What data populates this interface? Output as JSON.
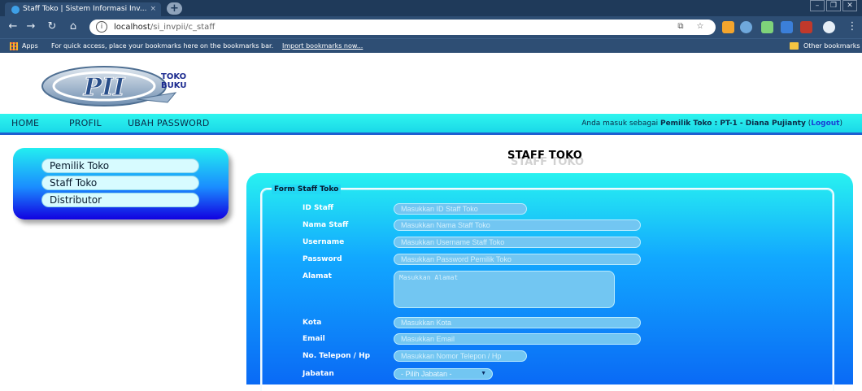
{
  "browser": {
    "tab_title": "Staff Toko | Sistem Informasi Inv...",
    "tab_close": "×",
    "new_tab": "+",
    "url_host": "localhost",
    "url_path": "/si_invpii/c_staff",
    "bookmarks_apps": "Apps",
    "bookmarks_prompt": "For quick access, place your bookmarks here on the bookmarks bar.",
    "bookmarks_import": "Import bookmarks now...",
    "other_bookmarks": "Other bookmarks"
  },
  "header": {
    "logo_letters": "PII",
    "logo_word1": "TOKO",
    "logo_word2": "BUKU"
  },
  "menu": {
    "items": [
      "HOME",
      "PROFIL",
      "UBAH PASSWORD"
    ],
    "login_prefix": "Anda masuk sebagai",
    "login_user": "Pemilik Toko : PT-1 - Diana Pujianty",
    "logout_open": "(",
    "logout": "Logout",
    "logout_close": ")"
  },
  "sidebar": {
    "items": [
      "Pemilik Toko",
      "Staff Toko",
      "Distributor"
    ]
  },
  "main": {
    "title": "STAFF TOKO",
    "form_legend": "Form Staff Toko",
    "fields": [
      {
        "label": "ID Staff",
        "placeholder": "Masukkan ID Staff Toko"
      },
      {
        "label": "Nama Staff",
        "placeholder": "Masukkan Nama Staff Toko"
      },
      {
        "label": "Username",
        "placeholder": "Masukkan Username Staff Toko"
      },
      {
        "label": "Password",
        "placeholder": "Masukkan Password Pemilik Toko"
      },
      {
        "label": "Alamat",
        "placeholder": "Masukkan Alamat"
      },
      {
        "label": "Kota",
        "placeholder": "Masukkan Kota"
      },
      {
        "label": "Email",
        "placeholder": "Masukkan Email"
      },
      {
        "label": "No. Telepon / Hp",
        "placeholder": "Masukkan Nomor Telepon / Hp"
      },
      {
        "label": "Jabatan",
        "selected": "- Pilih Jabatan -"
      }
    ]
  },
  "colors": {
    "menubar": "#2ff5ee",
    "panel_top": "#28f2f0",
    "panel_bottom": "#0a6af5",
    "logout_link": "#1a3fd6"
  }
}
